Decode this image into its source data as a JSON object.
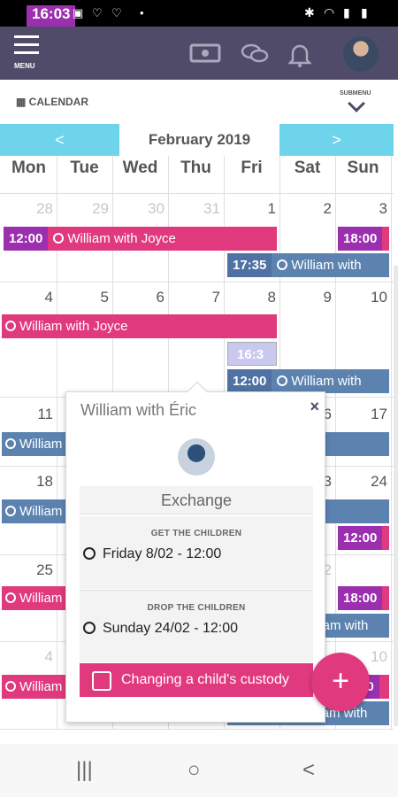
{
  "status_bar": {
    "time": "16:03"
  },
  "header": {
    "menu_label": "MENU"
  },
  "calendar": {
    "section_label": "CALENDAR",
    "submenu_label": "SUBMENU",
    "prev": "<",
    "next": ">",
    "month": "February 2019",
    "day_names": [
      "Mon",
      "Tue",
      "Wed",
      "Thu",
      "Fri",
      "Sat",
      "Sun"
    ],
    "weeks": [
      [
        "28",
        "29",
        "30",
        "31",
        "1",
        "2",
        "3"
      ],
      [
        "4",
        "5",
        "6",
        "7",
        "8",
        "9",
        "10"
      ],
      [
        "11",
        "",
        "",
        "",
        "",
        "16",
        "17"
      ],
      [
        "18",
        "",
        "",
        "",
        "",
        "23",
        "24"
      ],
      [
        "25",
        "",
        "",
        "",
        "",
        "2",
        ""
      ],
      [
        "4",
        "",
        "",
        "",
        "",
        "",
        "10"
      ]
    ],
    "events": [
      {
        "time": "12:00",
        "label": "William with Joyce"
      },
      {
        "time": "18:00",
        "label": ""
      },
      {
        "time": "17:35",
        "label": "William with"
      },
      {
        "time": "",
        "label": "William with Joyce"
      },
      {
        "time": "16:3",
        "label": ""
      },
      {
        "time": "12:00",
        "label": "William with"
      },
      {
        "time": "",
        "label": "William"
      },
      {
        "time": "",
        "label": "William"
      },
      {
        "time": "12:00",
        "label": ""
      },
      {
        "time": "",
        "label": "William"
      },
      {
        "time": "18:00",
        "label": ""
      },
      {
        "time": "",
        "label": "liam with"
      },
      {
        "time": "",
        "label": "William"
      },
      {
        "time": "",
        "label": "liam with"
      },
      {
        "time": "00",
        "label": ""
      }
    ]
  },
  "popup": {
    "title": "William with Éric",
    "close": "×",
    "type": "Exchange",
    "get_caption": "GET THE CHILDREN",
    "get_value": "Friday 8/02 - 12:00",
    "drop_caption": "DROP THE CHILDREN",
    "drop_value": "Sunday 24/02 - 12:00",
    "action": "Changing a child's custody"
  },
  "fab": {
    "label": "+"
  },
  "navbar": {
    "recent": "|||",
    "home": "○",
    "back": "<"
  }
}
